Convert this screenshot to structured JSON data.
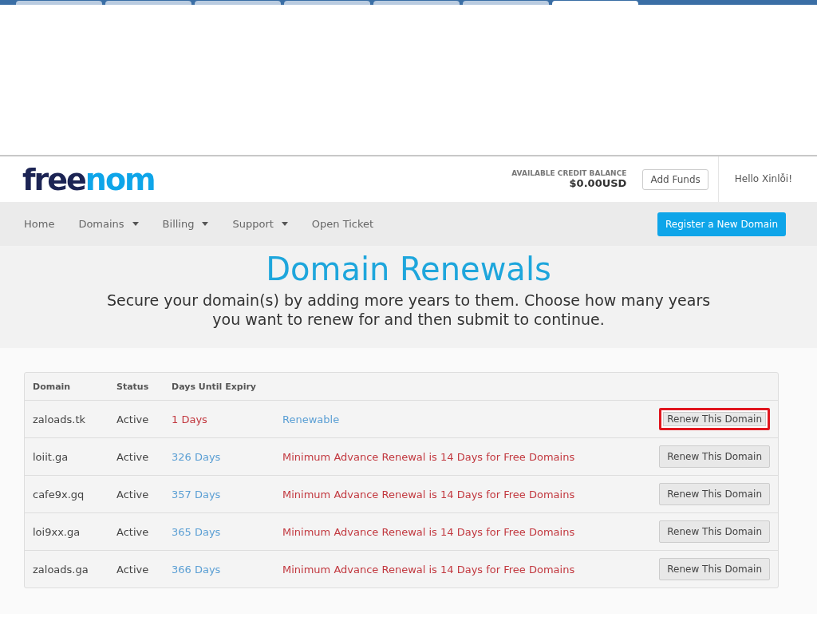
{
  "browser_tabs": [
    {
      "selected": false
    },
    {
      "selected": false
    },
    {
      "selected": false
    },
    {
      "selected": false
    },
    {
      "selected": false
    },
    {
      "selected": false
    },
    {
      "selected": true
    }
  ],
  "logo": {
    "first": "free",
    "second": "nom"
  },
  "credit": {
    "label": "AVAILABLE CREDIT BALANCE",
    "amount": "$0.00USD"
  },
  "add_funds": "Add Funds",
  "greeting": "Hello Xinlỗi!",
  "nav": [
    {
      "label": "Home",
      "dropdown": false
    },
    {
      "label": "Domains",
      "dropdown": true
    },
    {
      "label": "Billing",
      "dropdown": true
    },
    {
      "label": "Support",
      "dropdown": true
    },
    {
      "label": "Open Ticket",
      "dropdown": false
    }
  ],
  "register_button": "Register a New Domain",
  "hero": {
    "title": "Domain Renewals",
    "subtitle": "Secure your domain(s) by adding more years to them. Choose how many years you want to renew for and then submit to continue."
  },
  "table": {
    "columns": [
      "Domain",
      "Status",
      "Days Until Expiry"
    ],
    "rows": [
      {
        "domain": "zaloads.tk",
        "status": "Active",
        "days": "1 Days",
        "urgent": true,
        "note": "Renewable",
        "kind": "ok",
        "button": "Renew This Domain",
        "highlighted": true
      },
      {
        "domain": "loiit.ga",
        "status": "Active",
        "days": "326 Days",
        "urgent": false,
        "note": "Minimum Advance Renewal is 14 Days for Free Domains",
        "kind": "warning",
        "button": "Renew This Domain",
        "highlighted": false
      },
      {
        "domain": "cafe9x.gq",
        "status": "Active",
        "days": "357 Days",
        "urgent": false,
        "note": "Minimum Advance Renewal is 14 Days for Free Domains",
        "kind": "warning",
        "button": "Renew This Domain",
        "highlighted": false
      },
      {
        "domain": "loi9xx.ga",
        "status": "Active",
        "days": "365 Days",
        "urgent": false,
        "note": "Minimum Advance Renewal is 14 Days for Free Domains",
        "kind": "warning",
        "button": "Renew This Domain",
        "highlighted": false
      },
      {
        "domain": "zaloads.ga",
        "status": "Active",
        "days": "366 Days",
        "urgent": false,
        "note": "Minimum Advance Renewal is 14 Days for Free Domains",
        "kind": "warning",
        "button": "Renew This Domain",
        "highlighted": false
      }
    ]
  }
}
